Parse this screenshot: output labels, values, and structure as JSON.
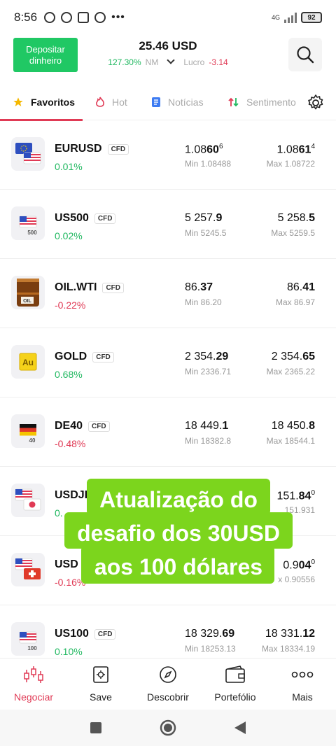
{
  "status_bar": {
    "time": "8:56",
    "dots": "•••",
    "network": "4G",
    "battery": "92"
  },
  "header": {
    "deposit_line1": "Depositar",
    "deposit_line2": "dinheiro",
    "balance": "25.46 USD",
    "margin_pct": "127.30%",
    "margin_label": "NM",
    "profit_label": "Lucro",
    "profit_value": "-3.14"
  },
  "tabs": [
    {
      "label": "Favoritos"
    },
    {
      "label": "Hot"
    },
    {
      "label": "Notícias"
    },
    {
      "label": "Sentimento"
    }
  ],
  "instruments": [
    {
      "symbol": "EURUSD",
      "tag": "CFD",
      "change": "0.01%",
      "dir": "up",
      "bid_main": "1.08",
      "bid_bold": "60",
      "bid_sup": "6",
      "min": "Min 1.08488",
      "ask_main": "1.08",
      "ask_bold": "61",
      "ask_sup": "4",
      "max": "Max 1.08722"
    },
    {
      "symbol": "US500",
      "tag": "CFD",
      "change": "0.02%",
      "dir": "up",
      "bid_main": "5 257.",
      "bid_bold": "9",
      "bid_sup": "",
      "min": "Min 5245.5",
      "ask_main": "5 258.",
      "ask_bold": "5",
      "ask_sup": "",
      "max": "Max 5259.5"
    },
    {
      "symbol": "OIL.WTI",
      "tag": "CFD",
      "change": "-0.22%",
      "dir": "down",
      "bid_main": "86.",
      "bid_bold": "37",
      "bid_sup": "",
      "min": "Min 86.20",
      "ask_main": "86.",
      "ask_bold": "41",
      "ask_sup": "",
      "max": "Max 86.97"
    },
    {
      "symbol": "GOLD",
      "tag": "CFD",
      "change": "0.68%",
      "dir": "up",
      "bid_main": "2 354.",
      "bid_bold": "29",
      "bid_sup": "",
      "min": "Min 2336.71",
      "ask_main": "2 354.",
      "ask_bold": "65",
      "ask_sup": "",
      "max": "Max 2365.22"
    },
    {
      "symbol": "DE40",
      "tag": "CFD",
      "change": "-0.48%",
      "dir": "down",
      "bid_main": "18 449.",
      "bid_bold": "1",
      "bid_sup": "",
      "min": "Min 18382.8",
      "ask_main": "18 450.",
      "ask_bold": "8",
      "ask_sup": "",
      "max": "Max 18544.1"
    },
    {
      "symbol": "USDJI",
      "tag": "",
      "change": "0.",
      "dir": "up",
      "bid_main": "",
      "bid_bold": "",
      "bid_sup": "",
      "min": "",
      "ask_main": "151.",
      "ask_bold": "84",
      "ask_sup": "0",
      "max": "151.931"
    },
    {
      "symbol": "USD",
      "tag": "",
      "change": "-0.16%",
      "dir": "down",
      "bid_main": "",
      "bid_bold": "",
      "bid_sup": "",
      "min": "",
      "ask_main": "0.9",
      "ask_bold": "04",
      "ask_sup": "0",
      "max": "x 0.90556"
    },
    {
      "symbol": "US100",
      "tag": "CFD",
      "change": "0.10%",
      "dir": "up",
      "bid_main": "18 329.",
      "bid_bold": "69",
      "bid_sup": "",
      "min": "Min 18253.13",
      "ask_main": "18 331.",
      "ask_bold": "12",
      "ask_sup": "",
      "max": "Max 18334.19"
    }
  ],
  "overlay": {
    "line1": "Atualização do",
    "line2": "desafio dos 30USD",
    "line3": "aos 100 dólares"
  },
  "bottom_nav": [
    {
      "label": "Negociar"
    },
    {
      "label": "Save"
    },
    {
      "label": "Descobrir"
    },
    {
      "label": "Portefólio"
    },
    {
      "label": "Mais"
    }
  ],
  "icons": {
    "gold_icon_text": "Au",
    "us500_badge": "500",
    "de40_badge": "40",
    "us100_badge": "100",
    "oil_badge": "OIL"
  },
  "colors": {
    "accent_red": "#e03a55",
    "green": "#20c864",
    "overlay_green": "#7cd51d"
  }
}
